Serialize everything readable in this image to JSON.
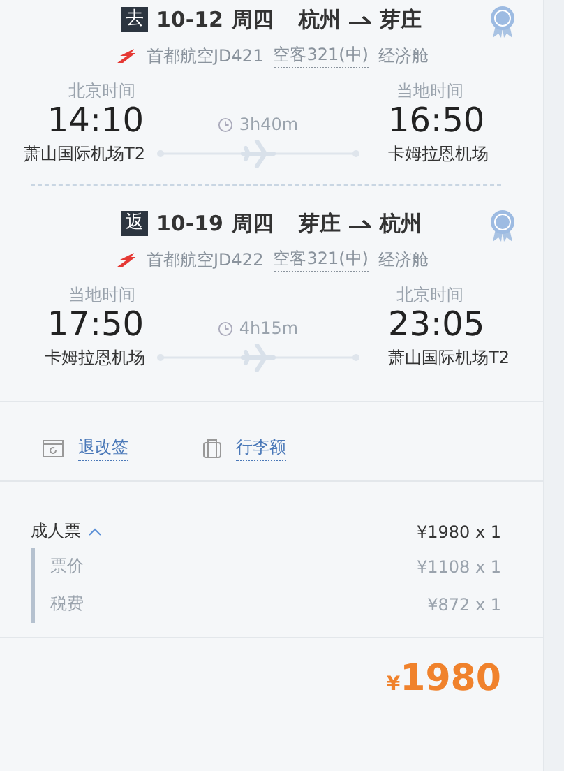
{
  "flights": [
    {
      "direction": "去",
      "date": "10-12",
      "weekday": "周四",
      "from": "杭州",
      "to": "芽庄",
      "airline": "首都航空JD421",
      "aircraft": "空客321(中)",
      "cabin": "经济舱",
      "depart": {
        "zone": "北京时间",
        "time": "14:10",
        "airport": "萧山国际机场T2"
      },
      "duration": "3h40m",
      "arrive": {
        "zone": "当地时间",
        "time": "16:50",
        "airport": "卡姆拉恩机场"
      }
    },
    {
      "direction": "返",
      "date": "10-19",
      "weekday": "周四",
      "from": "芽庄",
      "to": "杭州",
      "airline": "首都航空JD422",
      "aircraft": "空客321(中)",
      "cabin": "经济舱",
      "depart": {
        "zone": "当地时间",
        "time": "17:50",
        "airport": "卡姆拉恩机场"
      },
      "duration": "4h15m",
      "arrive": {
        "zone": "北京时间",
        "time": "23:05",
        "airport": "萧山国际机场T2"
      }
    }
  ],
  "links": [
    {
      "kind": "refund",
      "label": "退改签"
    },
    {
      "kind": "baggage",
      "label": "行李额"
    }
  ],
  "price": {
    "label": "成人票",
    "expanded": true,
    "amount": "¥1980 x 1",
    "items": [
      {
        "label": "票价",
        "amount": "¥1108 x 1"
      },
      {
        "label": "税费",
        "amount": "¥872 x 1"
      }
    ]
  },
  "total": {
    "currency": "¥",
    "amount": "1980"
  }
}
